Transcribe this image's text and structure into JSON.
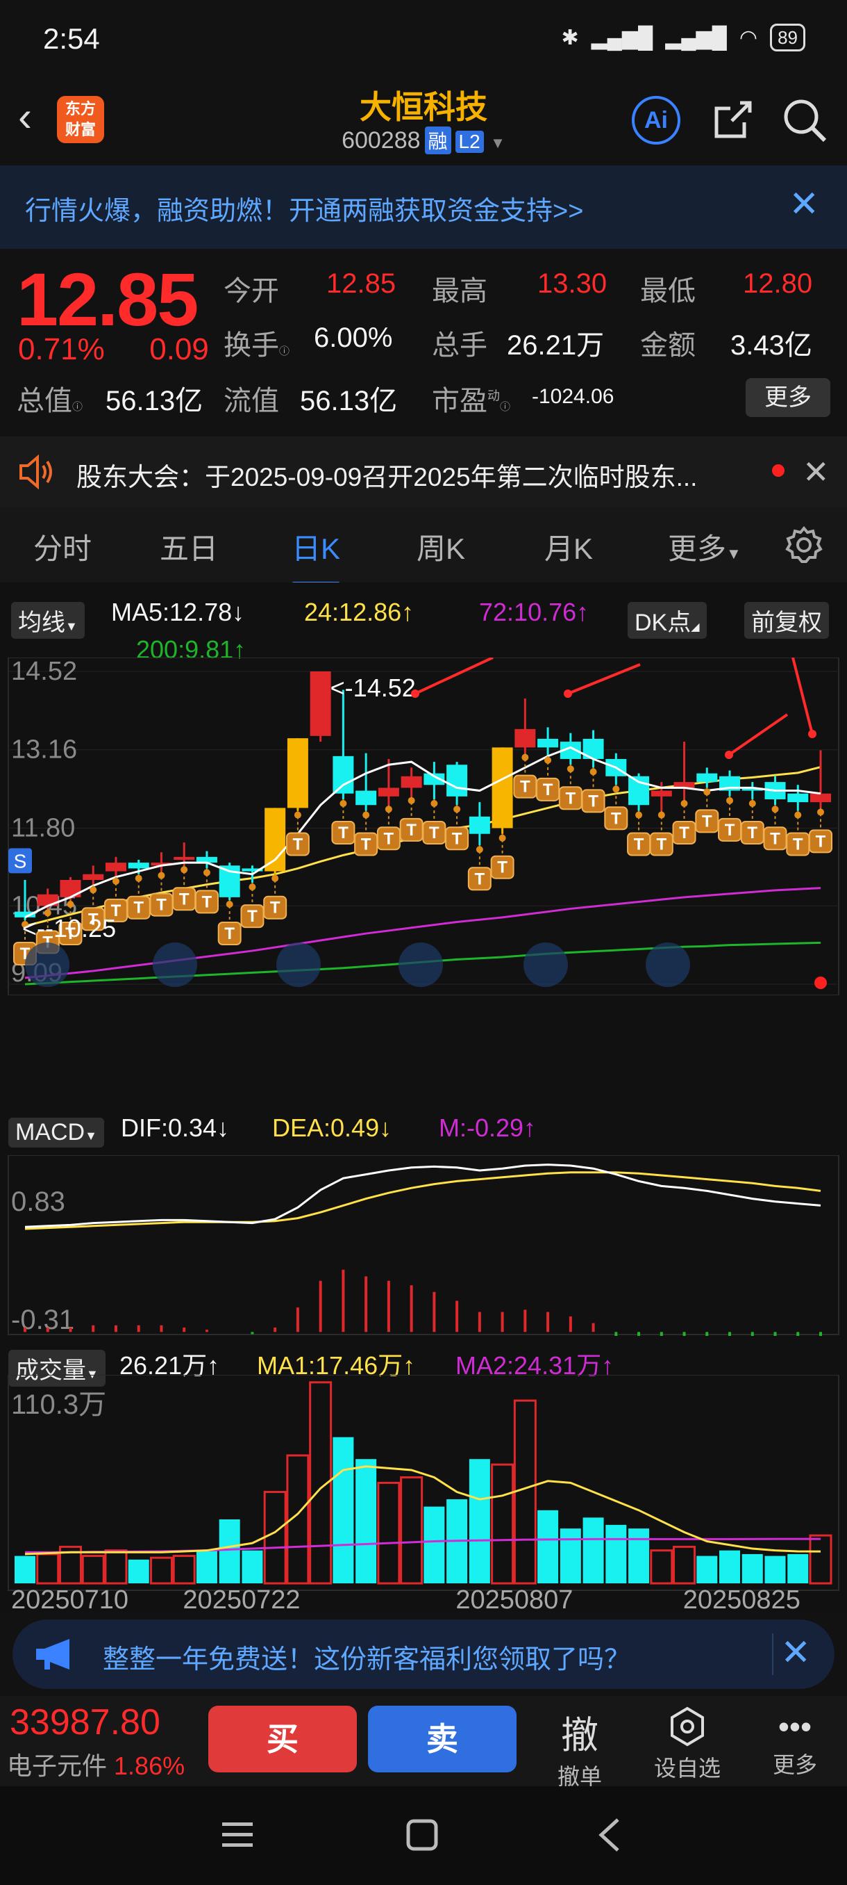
{
  "status": {
    "time": "2:54",
    "battery": "89"
  },
  "header": {
    "logo_line1": "东方",
    "logo_line2": "财富",
    "stock_name": "大恒科技",
    "stock_code": "600288",
    "tag_rong": "融",
    "tag_l2": "L2",
    "ai_label": "Ai"
  },
  "banner": {
    "text": "行情火爆，融资助燃！开通两融获取资金支持>>"
  },
  "quote": {
    "price": "12.85",
    "change_pct": "0.71%",
    "change": "0.09",
    "open_label": "今开",
    "open": "12.85",
    "high_label": "最高",
    "high": "13.30",
    "low_label": "最低",
    "low": "12.80",
    "turnover_label": "换手",
    "turnover": "6.00%",
    "volume_label": "总手",
    "volume": "26.21万",
    "amount_label": "金额",
    "amount": "3.43亿",
    "mcap_label": "总值",
    "mcap": "56.13亿",
    "float_label": "流值",
    "float": "56.13亿",
    "pe_label": "市盈",
    "pe_sup": "动",
    "pe": "-1024.06",
    "more": "更多"
  },
  "notice": {
    "text": "股东大会：于2025-09-09召开2025年第二次临时股东..."
  },
  "tabs": [
    "分时",
    "五日",
    "日K",
    "周K",
    "月K",
    "更多"
  ],
  "active_tab": 2,
  "chart": {
    "ma_selector": "均线",
    "ma5": "MA5:12.78",
    "ma24": "24:12.86",
    "ma72": "72:10.76",
    "ma200": "200:9.81",
    "dk_button": "DK点",
    "adjust_button": "前复权",
    "price_ticks": [
      "14.52",
      "13.16",
      "11.80",
      "10.45",
      "9.09"
    ],
    "high_annotation": "<-14.52",
    "low_annotation": "<--10.25",
    "s_marker": "S",
    "t_marker": "T",
    "macd_selector": "MACD",
    "dif": "DIF:0.34",
    "dea": "DEA:0.49",
    "m": "M:-0.29",
    "macd_ticks": [
      "0.83",
      "-0.31"
    ],
    "vol_selector": "成交量",
    "vol": "26.21万",
    "vol_ma1": "MA1:17.46万",
    "vol_ma2": "MA2:24.31万",
    "vol_tick": "110.3万",
    "dates": [
      "20250710",
      "20250722",
      "20250807",
      "20250825"
    ],
    "colors": {
      "up": "#e0282b",
      "down": "#19f0f0",
      "ma5": "#ffffff",
      "ma24": "#ffe14a",
      "ma72": "#d02cd4",
      "ma200": "#1fb52a",
      "limit": "#f7b500"
    }
  },
  "chart_data": {
    "type": "candlestick",
    "candles": [
      {
        "o": 10.35,
        "c": 10.25,
        "h": 10.9,
        "l": 10.2
      },
      {
        "o": 10.45,
        "c": 10.65,
        "h": 10.75,
        "l": 10.4
      },
      {
        "o": 10.6,
        "c": 10.9,
        "h": 10.95,
        "l": 10.55
      },
      {
        "o": 10.9,
        "c": 11.0,
        "h": 11.15,
        "l": 10.8
      },
      {
        "o": 11.05,
        "c": 11.2,
        "h": 11.3,
        "l": 10.95
      },
      {
        "o": 11.2,
        "c": 11.1,
        "h": 11.25,
        "l": 11.0
      },
      {
        "o": 11.15,
        "c": 11.2,
        "h": 11.38,
        "l": 11.05
      },
      {
        "o": 11.25,
        "c": 11.3,
        "h": 11.55,
        "l": 11.15
      },
      {
        "o": 11.3,
        "c": 11.2,
        "h": 11.4,
        "l": 11.1
      },
      {
        "o": 11.15,
        "c": 10.6,
        "h": 11.2,
        "l": 10.55
      },
      {
        "o": 11.1,
        "c": 11.05,
        "h": 11.15,
        "l": 10.85
      },
      {
        "o": 11.05,
        "c": 12.15,
        "h": 12.15,
        "l": 11.0
      },
      {
        "o": 12.15,
        "c": 13.36,
        "h": 13.36,
        "l": 12.1
      },
      {
        "o": 13.4,
        "c": 14.52,
        "h": 14.52,
        "l": 13.3
      },
      {
        "o": 13.05,
        "c": 12.4,
        "h": 14.2,
        "l": 12.3
      },
      {
        "o": 12.45,
        "c": 12.2,
        "h": 13.1,
        "l": 12.1
      },
      {
        "o": 12.35,
        "c": 12.5,
        "h": 13.0,
        "l": 12.2
      },
      {
        "o": 12.5,
        "c": 12.7,
        "h": 12.85,
        "l": 12.35
      },
      {
        "o": 12.75,
        "c": 12.55,
        "h": 12.95,
        "l": 12.3
      },
      {
        "o": 12.9,
        "c": 12.35,
        "h": 12.95,
        "l": 12.2
      },
      {
        "o": 12.0,
        "c": 11.7,
        "h": 12.25,
        "l": 11.5
      },
      {
        "o": 11.8,
        "c": 13.2,
        "h": 13.2,
        "l": 11.7
      },
      {
        "o": 13.2,
        "c": 13.52,
        "h": 14.05,
        "l": 13.1
      },
      {
        "o": 13.35,
        "c": 13.2,
        "h": 13.55,
        "l": 13.05
      },
      {
        "o": 13.3,
        "c": 13.0,
        "h": 13.45,
        "l": 12.9
      },
      {
        "o": 13.35,
        "c": 13.0,
        "h": 13.5,
        "l": 12.85
      },
      {
        "o": 13.0,
        "c": 12.7,
        "h": 13.1,
        "l": 12.55
      },
      {
        "o": 12.7,
        "c": 12.2,
        "h": 12.75,
        "l": 12.1
      },
      {
        "o": 12.35,
        "c": 12.45,
        "h": 12.6,
        "l": 12.1
      },
      {
        "o": 12.5,
        "c": 12.6,
        "h": 13.3,
        "l": 12.3
      },
      {
        "o": 12.75,
        "c": 12.6,
        "h": 12.85,
        "l": 12.5
      },
      {
        "o": 12.7,
        "c": 12.45,
        "h": 12.8,
        "l": 12.35
      },
      {
        "o": 12.5,
        "c": 12.45,
        "h": 12.6,
        "l": 12.3
      },
      {
        "o": 12.6,
        "c": 12.3,
        "h": 12.7,
        "l": 12.2
      },
      {
        "o": 12.4,
        "c": 12.25,
        "h": 12.55,
        "l": 12.1
      },
      {
        "o": 12.25,
        "c": 12.4,
        "h": 13.15,
        "l": 12.15
      }
    ],
    "limit_up_candles": [
      11,
      12,
      21
    ],
    "ma5": [
      10.25,
      10.45,
      10.6,
      10.8,
      10.95,
      11.05,
      11.15,
      11.2,
      11.2,
      11.05,
      11.0,
      11.25,
      11.7,
      12.2,
      12.55,
      12.75,
      12.9,
      12.95,
      12.7,
      12.5,
      12.45,
      12.65,
      12.85,
      13.05,
      13.2,
      13.0,
      12.85,
      12.6,
      12.5,
      12.5,
      12.45,
      12.5,
      12.5,
      12.45,
      12.45,
      12.4
    ],
    "ma24": [
      10.1,
      10.2,
      10.3,
      10.4,
      10.5,
      10.6,
      10.68,
      10.75,
      10.82,
      10.88,
      10.93,
      11.0,
      11.1,
      11.22,
      11.33,
      11.42,
      11.52,
      11.62,
      11.72,
      11.8,
      11.86,
      11.95,
      12.05,
      12.15,
      12.25,
      12.33,
      12.4,
      12.45,
      12.5,
      12.55,
      12.6,
      12.65,
      12.68,
      12.72,
      12.76,
      12.86
    ],
    "ma72": [
      9.2,
      9.24,
      9.28,
      9.32,
      9.37,
      9.42,
      9.47,
      9.52,
      9.57,
      9.62,
      9.67,
      9.73,
      9.79,
      9.85,
      9.91,
      9.97,
      10.02,
      10.07,
      10.12,
      10.17,
      10.21,
      10.25,
      10.3,
      10.35,
      10.4,
      10.44,
      10.48,
      10.52,
      10.56,
      10.6,
      10.63,
      10.66,
      10.69,
      10.72,
      10.74,
      10.76
    ],
    "ma200": [
      9.09,
      9.11,
      9.13,
      9.15,
      9.17,
      9.19,
      9.21,
      9.23,
      9.25,
      9.27,
      9.29,
      9.31,
      9.33,
      9.35,
      9.37,
      9.4,
      9.43,
      9.46,
      9.49,
      9.52,
      9.54,
      9.56,
      9.59,
      9.62,
      9.64,
      9.66,
      9.68,
      9.7,
      9.72,
      9.74,
      9.75,
      9.77,
      9.78,
      9.79,
      9.8,
      9.81
    ],
    "t_marks": [
      0,
      1,
      2,
      3,
      4,
      5,
      6,
      7,
      8,
      9,
      10,
      11,
      12,
      14,
      15,
      16,
      17,
      18,
      19,
      20,
      21,
      22,
      23,
      24,
      25,
      26,
      27,
      28,
      29,
      30,
      31,
      32,
      33,
      34,
      35
    ],
    "macd_dif": [
      0.12,
      0.13,
      0.14,
      0.16,
      0.17,
      0.18,
      0.19,
      0.19,
      0.18,
      0.17,
      0.16,
      0.2,
      0.32,
      0.5,
      0.62,
      0.66,
      0.7,
      0.73,
      0.74,
      0.73,
      0.7,
      0.72,
      0.75,
      0.76,
      0.75,
      0.72,
      0.66,
      0.59,
      0.54,
      0.52,
      0.49,
      0.45,
      0.41,
      0.38,
      0.36,
      0.34
    ],
    "macd_dea": [
      0.1,
      0.11,
      0.12,
      0.13,
      0.14,
      0.15,
      0.16,
      0.17,
      0.17,
      0.17,
      0.17,
      0.18,
      0.21,
      0.27,
      0.34,
      0.41,
      0.47,
      0.52,
      0.56,
      0.59,
      0.61,
      0.63,
      0.65,
      0.67,
      0.68,
      0.68,
      0.68,
      0.67,
      0.65,
      0.63,
      0.61,
      0.59,
      0.57,
      0.54,
      0.52,
      0.49
    ],
    "macd_m": [
      0.04,
      0.04,
      0.04,
      0.06,
      0.06,
      0.06,
      0.06,
      0.04,
      0.02,
      0.0,
      -0.02,
      0.04,
      0.22,
      0.46,
      0.56,
      0.5,
      0.46,
      0.42,
      0.36,
      0.28,
      0.18,
      0.18,
      0.2,
      0.18,
      0.14,
      0.08,
      -0.04,
      -0.16,
      -0.22,
      -0.22,
      -0.24,
      -0.28,
      -0.32,
      -0.32,
      -0.32,
      -0.29
    ],
    "volume_wan": [
      15,
      16,
      20,
      15,
      18,
      13,
      14,
      15,
      18,
      35,
      18,
      50,
      70,
      110,
      80,
      68,
      55,
      58,
      42,
      46,
      68,
      65,
      100,
      40,
      30,
      36,
      32,
      30,
      18,
      20,
      15,
      18,
      16,
      15,
      16,
      26.21
    ],
    "vol_ma1": [
      16,
      16.5,
      17,
      17,
      17,
      17,
      17,
      17.5,
      18,
      20,
      22,
      28,
      38,
      52,
      62,
      64,
      63,
      62,
      58,
      50,
      46,
      48,
      52,
      56,
      55,
      50,
      45,
      40,
      34,
      28,
      23,
      21,
      19,
      18,
      17.5,
      17.46
    ],
    "vol_ma2": [
      17,
      17,
      17,
      17.2,
      17.3,
      17.4,
      17.5,
      17.8,
      18,
      18.5,
      19,
      19.5,
      20,
      20.5,
      21,
      21.5,
      22,
      22.5,
      23,
      23.3,
      23.5,
      23.7,
      23.9,
      24,
      24.1,
      24.2,
      24.2,
      24.2,
      24.2,
      24.2,
      24.2,
      24.2,
      24.25,
      24.28,
      24.3,
      24.31
    ],
    "price_ylim": [
      9.09,
      14.52
    ],
    "macd_ylim": [
      -0.31,
      0.83
    ],
    "vol_ylim": [
      0,
      110.3
    ]
  },
  "ad": {
    "text": "整整一年免费送！这份新客福利您领取了吗？"
  },
  "bottom": {
    "index_value": "33987.80",
    "index_name": "电子元件",
    "index_pct": "1.86%",
    "buy": "买",
    "sell": "卖",
    "cancel_icon_text": "撤",
    "cancel_label": "撤单",
    "watch_label": "设自选",
    "more_label": "更多"
  }
}
